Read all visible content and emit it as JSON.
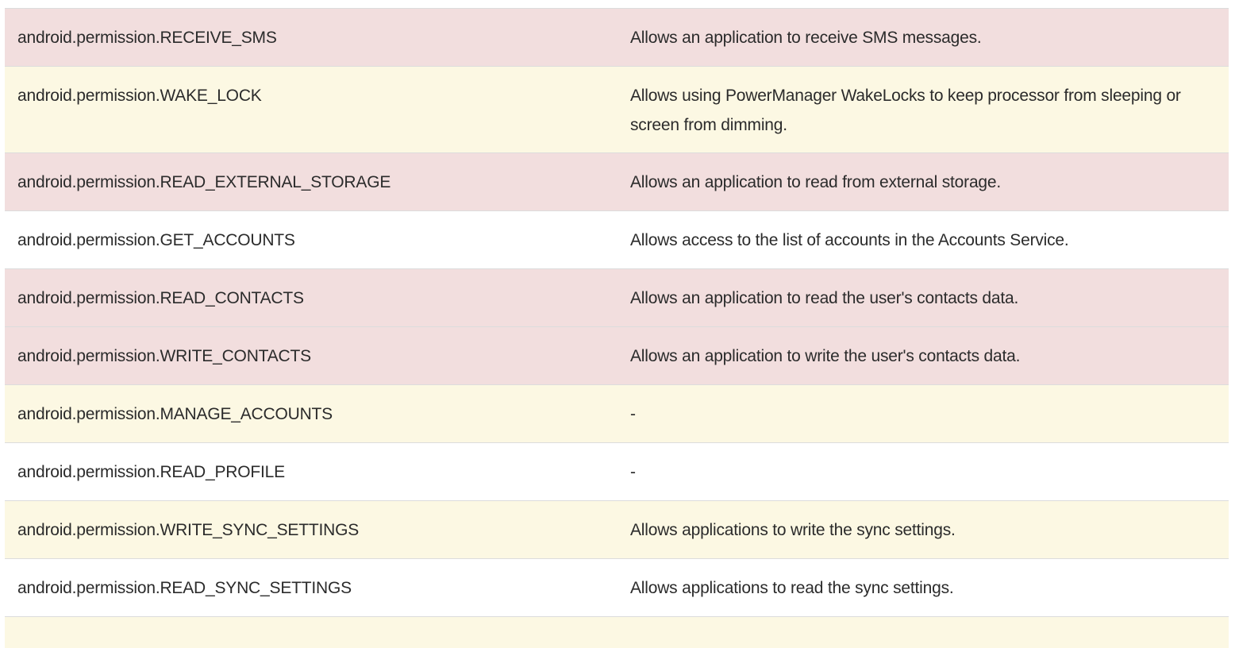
{
  "colors": {
    "danger_row": "#f2dede",
    "warning_row": "#fcf8e3",
    "normal_row": "#ffffff",
    "border": "#dcdcdc",
    "text": "#2b2b2b"
  },
  "permissions": [
    {
      "name": "android.permission.RECEIVE_SMS",
      "description": "Allows an application to receive SMS messages.",
      "level": "danger"
    },
    {
      "name": "android.permission.WAKE_LOCK",
      "description": "Allows using PowerManager WakeLocks to keep processor from sleeping or screen from dimming.",
      "level": "warning"
    },
    {
      "name": "android.permission.READ_EXTERNAL_STORAGE",
      "description": "Allows an application to read from external storage.",
      "level": "danger"
    },
    {
      "name": "android.permission.GET_ACCOUNTS",
      "description": "Allows access to the list of accounts in the Accounts Service.",
      "level": "normal"
    },
    {
      "name": "android.permission.READ_CONTACTS",
      "description": "Allows an application to read the user's contacts data.",
      "level": "danger"
    },
    {
      "name": "android.permission.WRITE_CONTACTS",
      "description": "Allows an application to write the user's contacts data.",
      "level": "danger"
    },
    {
      "name": "android.permission.MANAGE_ACCOUNTS",
      "description": "-",
      "level": "warning"
    },
    {
      "name": "android.permission.READ_PROFILE",
      "description": "-",
      "level": "normal"
    },
    {
      "name": "android.permission.WRITE_SYNC_SETTINGS",
      "description": "Allows applications to write the sync settings.",
      "level": "warning"
    },
    {
      "name": "android.permission.READ_SYNC_SETTINGS",
      "description": "Allows applications to read the sync settings.",
      "level": "normal"
    },
    {
      "name": "",
      "description": "",
      "level": "warning"
    }
  ]
}
